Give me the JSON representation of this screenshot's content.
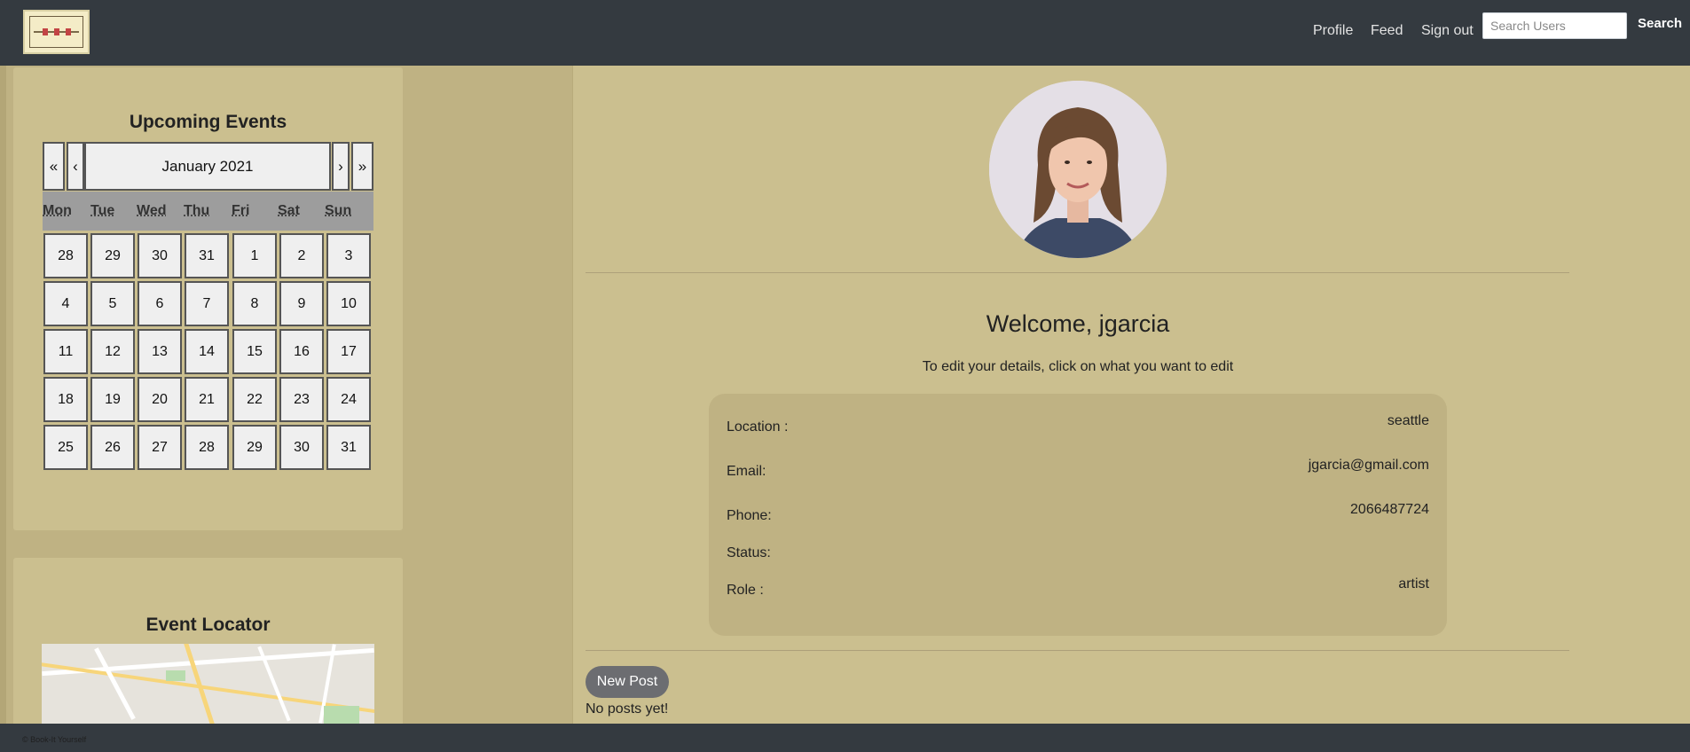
{
  "nav": {
    "links": [
      "Profile",
      "Feed",
      "Sign out"
    ],
    "search_placeholder": "Search Users",
    "search_button": "Search"
  },
  "calendar": {
    "title": "Upcoming Events",
    "month_label": "January 2021",
    "prev_year": "«",
    "prev_month": "‹",
    "next_month": "›",
    "next_year": "»",
    "weekdays": [
      "Mon",
      "Tue",
      "Wed",
      "Thu",
      "Fri",
      "Sat",
      "Sun"
    ],
    "weeks": [
      [
        "28",
        "29",
        "30",
        "31",
        "1",
        "2",
        "3"
      ],
      [
        "4",
        "5",
        "6",
        "7",
        "8",
        "9",
        "10"
      ],
      [
        "11",
        "12",
        "13",
        "14",
        "15",
        "16",
        "17"
      ],
      [
        "18",
        "19",
        "20",
        "21",
        "22",
        "23",
        "24"
      ],
      [
        "25",
        "26",
        "27",
        "28",
        "29",
        "30",
        "31"
      ]
    ]
  },
  "locator": {
    "title": "Event Locator"
  },
  "profile": {
    "welcome": "Welcome, jgarcia",
    "subtitle": "To edit your details, click on what you want to edit",
    "fields": [
      {
        "label": "Location :",
        "value": "seattle"
      },
      {
        "label": "Email:",
        "value": "jgarcia@gmail.com"
      },
      {
        "label": "Phone:",
        "value": "2066487724"
      },
      {
        "label": "Status:",
        "value": ""
      },
      {
        "label": "Role :",
        "value": "artist"
      }
    ]
  },
  "posts": {
    "new_post_label": "New Post",
    "empty_text": "No posts yet!"
  },
  "footer": {
    "text": "© Book-It Yourself"
  },
  "colors": {
    "navbar": "#343a40",
    "page_bg": "#bfb283",
    "card_bg": "#cbbf8f",
    "button_gray": "#6c6d71"
  }
}
